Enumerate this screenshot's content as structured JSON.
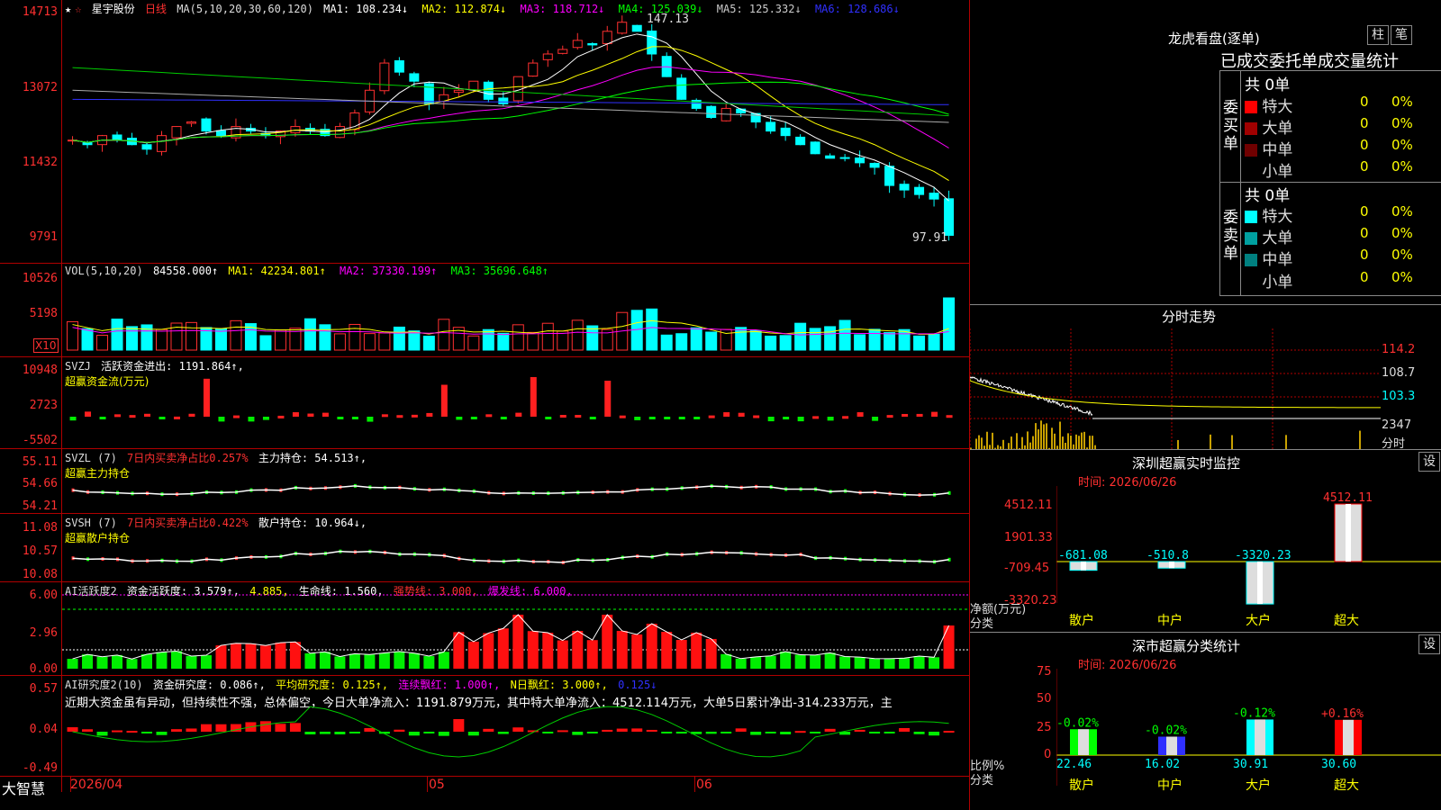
{
  "stock": {
    "name": "星宇股份",
    "period": "日线"
  },
  "main": {
    "ma_label": "MA(5,10,20,30,60,120)",
    "ma": [
      {
        "k": "MA1",
        "v": "108.234↓",
        "c": "#ffffff"
      },
      {
        "k": "MA2",
        "v": "112.874↓",
        "c": "#ffff00"
      },
      {
        "k": "MA3",
        "v": "118.712↓",
        "c": "#ff00ff"
      },
      {
        "k": "MA4",
        "v": "125.039↓",
        "c": "#00ff00"
      },
      {
        "k": "MA5",
        "v": "125.332↓",
        "c": "#cccccc"
      },
      {
        "k": "MA6",
        "v": "128.686↓",
        "c": "#3030ff"
      }
    ],
    "y_ticks": [
      "14713",
      "13072",
      "11432",
      "9791"
    ],
    "high_note": "147.13",
    "low_note": "97.91"
  },
  "vol": {
    "label": "VOL(5,10,20)",
    "value": "84558.000↑",
    "ma": [
      {
        "k": "MA1",
        "v": "42234.801↑",
        "c": "#ffff00"
      },
      {
        "k": "MA2",
        "v": "37330.199↑",
        "c": "#ff00ff"
      },
      {
        "k": "MA3",
        "v": "35696.648↑",
        "c": "#00ff00"
      }
    ],
    "y_ticks": [
      "10526",
      "5198"
    ],
    "unit": "X10"
  },
  "svzj": {
    "name": "SVZJ",
    "desc": "活跃资金进出: 1191.864↑,",
    "sub": "超赢资金流(万元)",
    "y_ticks": [
      "10948",
      "2723",
      "-5502"
    ]
  },
  "svzl": {
    "name": "SVZL (7)",
    "desc1": "7日内买卖净占比0.257%",
    "desc2": "主力持仓: 54.513↑,",
    "sub": "超赢主力持仓",
    "y_ticks": [
      "55.11",
      "54.66",
      "54.21"
    ]
  },
  "svsh": {
    "name": "SVSH (7)",
    "desc1": "7日内买卖净占比0.422%",
    "desc2": "散户持仓: 10.964↓,",
    "sub": "超赢散户持仓",
    "y_ticks": [
      "11.08",
      "10.57",
      "10.08"
    ]
  },
  "ai1": {
    "name": "AI活跃度2",
    "d1": "资金活跃度: 3.579↑,",
    "d2": "4.885,",
    "d3": "生命线: 1.560,",
    "d4": "强势线: 3.000,",
    "d5": "爆发线: 6.000,",
    "y_ticks": [
      "6.00",
      "2.96",
      "0.00"
    ]
  },
  "ai2": {
    "name": "AI研究度2(10)",
    "d1": "资金研究度: 0.086↑,",
    "d2": "平均研究度: 0.125↑,",
    "d3": "连续飘红: 1.000↑,",
    "d4": "N日飘红: 3.000↑,",
    "d5": "0.125↓",
    "note": "近期大资金虽有异动，但持续性不强，总体偏空，今日大单净流入：1191.879万元，其中特大单净流入：4512.114万元，大单5日累计净出-314.233万元，主",
    "y_ticks": [
      "0.57",
      "0.04",
      "-0.49"
    ]
  },
  "xaxis": {
    "brand": "大智慧",
    "dates": [
      "2026/04",
      "05",
      "06"
    ]
  },
  "lhb": {
    "title": "龙虎看盘(逐单)",
    "btn1": "柱",
    "btn2": "笔",
    "sub": "已成交委托单成交量统计",
    "buy": {
      "side": "委买单",
      "total": "共 0单",
      "rows": [
        {
          "n": "特大",
          "v": "0",
          "p": "0%",
          "c": "#ff0000"
        },
        {
          "n": "大单",
          "v": "0",
          "p": "0%",
          "c": "#a00000"
        },
        {
          "n": "中单",
          "v": "0",
          "p": "0%",
          "c": "#700000"
        },
        {
          "n": "小单",
          "v": "0",
          "p": "0%",
          "c": "#000000"
        }
      ]
    },
    "sell": {
      "side": "委卖单",
      "total": "共 0单",
      "rows": [
        {
          "n": "特大",
          "v": "0",
          "p": "0%",
          "c": "#00ffff"
        },
        {
          "n": "大单",
          "v": "0",
          "p": "0%",
          "c": "#00a0a0"
        },
        {
          "n": "中单",
          "v": "0",
          "p": "0%",
          "c": "#008080"
        },
        {
          "n": "小单",
          "v": "0",
          "p": "0%",
          "c": "#000000"
        }
      ]
    }
  },
  "fenshi": {
    "title": "分时走势",
    "ticks": [
      "114.2",
      "108.7",
      "103.3"
    ],
    "vol": "2347",
    "unit": "分时"
  },
  "monitor": {
    "title": "深圳超赢实时监控",
    "btn": "设",
    "time": "时间: 2026/06/26",
    "ylabels": [
      "4512.11",
      "1901.33",
      "-709.45",
      "-3320.23"
    ],
    "foot1": "净额(万元)",
    "foot2": "分类",
    "bars": [
      {
        "cat": "散户",
        "v": "-681.08",
        "val": -681.08
      },
      {
        "cat": "中户",
        "v": "-510.8",
        "val": -510.8
      },
      {
        "cat": "大户",
        "v": "-3320.23",
        "val": -3320.23
      },
      {
        "cat": "超大",
        "v": "4512.11",
        "val": 4512.11
      }
    ]
  },
  "stats": {
    "title": "深市超赢分类统计",
    "btn": "设",
    "time": "时间: 2026/06/26",
    "ylabels": [
      "75",
      "50",
      "25",
      "0"
    ],
    "foot1": "比例%",
    "foot2": "分类",
    "bars": [
      {
        "cat": "散户",
        "pct": "-0.02%",
        "val": "22.46",
        "v": 22.46,
        "c": "#00ff00"
      },
      {
        "cat": "中户",
        "pct": "-0.02%",
        "val": "16.02",
        "v": 16.02,
        "c": "#3030ff"
      },
      {
        "cat": "大户",
        "pct": "-0.12%",
        "val": "30.91",
        "v": 30.91,
        "c": "#00ffff"
      },
      {
        "cat": "超大",
        "pct": "+0.16%",
        "val": "30.60",
        "v": 30.6,
        "c": "#ff0000"
      }
    ]
  },
  "chart_data": {
    "type": "candlestick",
    "title": "星宇股份 日线",
    "price_range": [
      97.91,
      147.13
    ],
    "high": 147.13,
    "low": 97.91,
    "x_labels": [
      "2026/04",
      "05",
      "06"
    ],
    "ma_last": {
      "MA1": 108.234,
      "MA2": 112.874,
      "MA3": 118.712,
      "MA4": 125.039,
      "MA5": 125.332,
      "MA6": 128.686
    }
  }
}
